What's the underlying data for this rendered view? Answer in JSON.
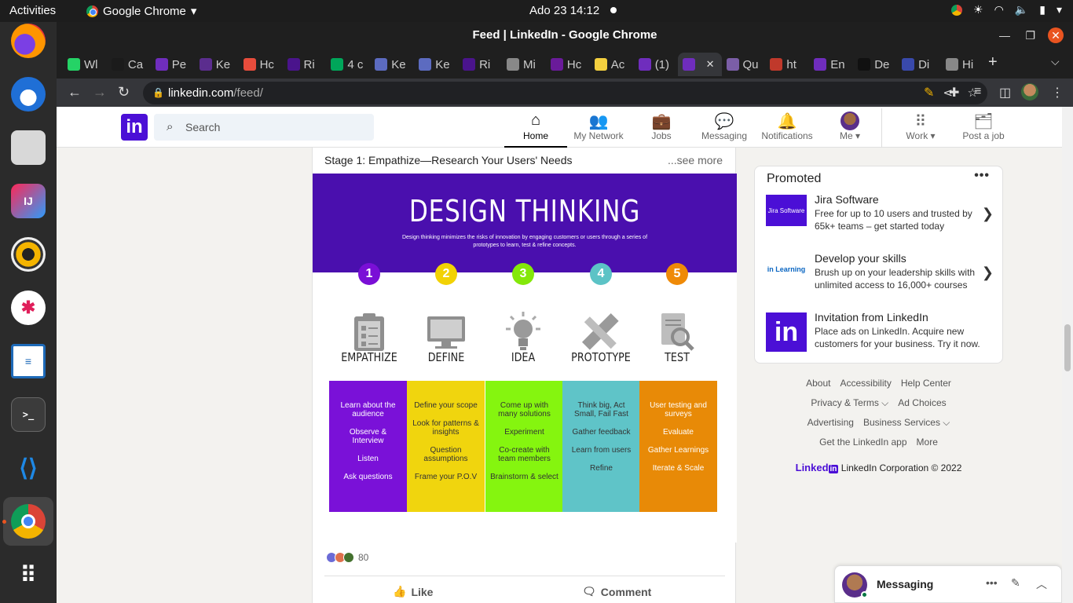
{
  "desktop": {
    "activities": "Activities",
    "app_name": "Google Chrome",
    "clock": "Ado 23  14:12"
  },
  "window": {
    "title": "Feed | LinkedIn - Google Chrome",
    "tabs": [
      {
        "label": "Wl",
        "color": "#25d366"
      },
      {
        "label": "Ca",
        "color": "#1b1b1b"
      },
      {
        "label": "Pe",
        "color": "#6f2dbd"
      },
      {
        "label": "Ke",
        "color": "#5b2d8e"
      },
      {
        "label": "Hc",
        "color": "#e74c3c"
      },
      {
        "label": "Ri",
        "color": "#4a148c"
      },
      {
        "label": "4 c",
        "color": "#00a65a"
      },
      {
        "label": "Ke",
        "color": "#5c6bc0"
      },
      {
        "label": "Ke",
        "color": "#5c6bc0"
      },
      {
        "label": "Ri",
        "color": "#4a148c"
      },
      {
        "label": "Mi",
        "color": "#888888"
      },
      {
        "label": "Hc",
        "color": "#6a1b9a"
      },
      {
        "label": "Ac",
        "color": "#f4d03f"
      },
      {
        "label": "(1)",
        "color": "#6f2dbd"
      },
      {
        "label": "",
        "color": "#6f2dbd"
      },
      {
        "label": "Qu",
        "color": "#7b5ea7"
      },
      {
        "label": "ht",
        "color": "#c0392b"
      },
      {
        "label": "En",
        "color": "#6f2dbd"
      },
      {
        "label": "De",
        "color": "#111111"
      },
      {
        "label": "Di",
        "color": "#3949ab"
      },
      {
        "label": "Hi",
        "color": "#888888"
      }
    ],
    "url_host": "linkedin.com",
    "url_path": "/feed/"
  },
  "linkedin": {
    "search_placeholder": "Search",
    "nav": [
      {
        "label": "Home",
        "icon": "home-icon",
        "glyph": "⌂"
      },
      {
        "label": "My Network",
        "icon": "network-icon",
        "glyph": "👥"
      },
      {
        "label": "Jobs",
        "icon": "briefcase-icon",
        "glyph": "💼"
      },
      {
        "label": "Messaging",
        "icon": "chat-icon",
        "glyph": "💬"
      },
      {
        "label": "Notifications",
        "icon": "bell-icon",
        "glyph": "🔔"
      },
      {
        "label": "Me ▾",
        "icon": "avatar",
        "glyph": "●"
      },
      {
        "label": "Work ▾",
        "icon": "grid-icon",
        "glyph": "⠿"
      },
      {
        "label": "Post a job",
        "icon": "post-job-icon",
        "glyph": "🗂"
      }
    ],
    "post": {
      "stage_text": "Stage 1: Empathize—Research Your Users' Needs",
      "see_more": "...see more",
      "infographic": {
        "title": "DESIGN THINKING",
        "subtitle": "Design thinking minimizes the risks of innovation by engaging customers or users through a series of prototypes to learn, test & refine concepts.",
        "steps": [
          {
            "num": "1",
            "label": "EMPATHIZE",
            "color": "#7a0fd6",
            "col_color": "#7a11d8",
            "icon": "clipboard-icon",
            "items": [
              "Learn about the audience",
              "Observe & Interview",
              "Listen",
              "Ask questions"
            ]
          },
          {
            "num": "2",
            "label": "DEFINE",
            "color": "#f2d204",
            "col_color": "#f0d50e",
            "icon": "monitor-icon",
            "items": [
              "Define your scope",
              "Look for patterns & insights",
              "Question assumptions",
              "Frame your P.O.V"
            ]
          },
          {
            "num": "3",
            "label": "IDEA",
            "color": "#84e80a",
            "col_color": "#85f50f",
            "icon": "lightbulb-icon",
            "items": [
              "Come up with many solutions",
              "Experiment",
              "Co-create with team members",
              "Brainstorm & select"
            ]
          },
          {
            "num": "4",
            "label": "PROTOTYPE",
            "color": "#5cc3c6",
            "col_color": "#5fc4c8",
            "icon": "ruler-pencil-icon",
            "items": [
              "Think big, Act Small, Fail Fast",
              "Gather feedback",
              "Learn from users",
              "Refine"
            ]
          },
          {
            "num": "5",
            "label": "TEST",
            "color": "#ef8a07",
            "col_color": "#e88a07",
            "icon": "search-document-icon",
            "items": [
              "User testing and surveys",
              "Evaluate",
              "Gather Learnings",
              "Iterate & Scale"
            ]
          }
        ]
      },
      "reaction_count": "80",
      "like_label": "Like",
      "comment_label": "Comment"
    },
    "promoted": {
      "title": "Promoted",
      "ads": [
        {
          "name": "Jira Software",
          "desc": "Free for up to 10 users and trusted by 65k+ teams – get started today",
          "logo_text": "Jira Software",
          "logo_color": "#4b0fd6"
        },
        {
          "name": "Develop your skills",
          "desc": "Brush up on your leadership skills with unlimited access to 16,000+ courses",
          "logo_text": "in Learning",
          "logo_color": "#ffffff"
        },
        {
          "name": "Invitation from LinkedIn",
          "desc": "Place ads on LinkedIn. Acquire new customers for your business. Try it now.",
          "logo_text": "in",
          "logo_color": "#4b0fd6"
        }
      ]
    },
    "footer": {
      "row1": [
        "About",
        "Accessibility",
        "Help Center"
      ],
      "row2": [
        "Privacy & Terms ⌵",
        "Ad Choices"
      ],
      "row3": [
        "Advertising",
        "Business Services ⌵"
      ],
      "row4": [
        "Get the LinkedIn app",
        "More"
      ],
      "brand": "Linked",
      "copyright": "LinkedIn Corporation © 2022"
    },
    "messaging_label": "Messaging"
  },
  "colors": {
    "brand": "#4b0fd6",
    "infographic_band": "#4a0fae"
  }
}
